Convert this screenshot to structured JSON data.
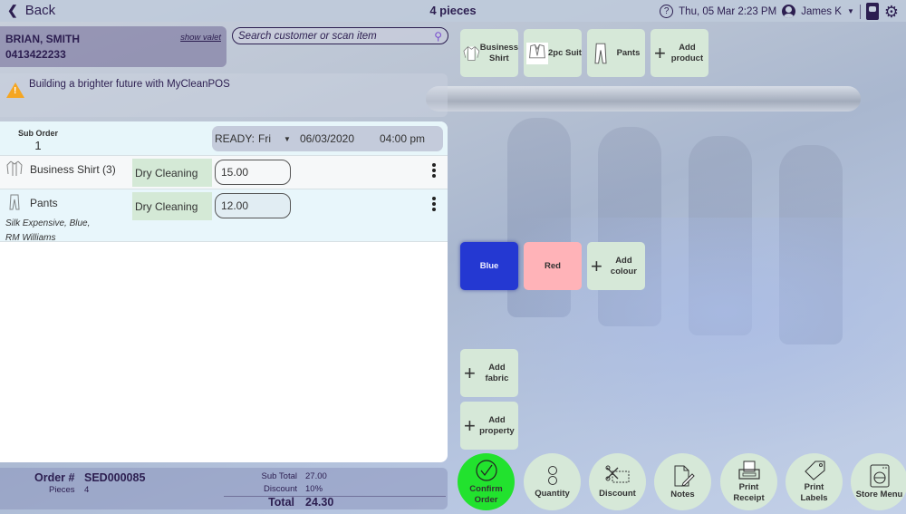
{
  "header": {
    "back_label": "Back",
    "title": "4 pieces",
    "datetime": "Thu, 05 Mar 2:23 PM",
    "user_name": "James K",
    "icons": [
      "help-icon",
      "user-icon",
      "chevron-down-icon",
      "kiosk-icon",
      "gear-icon"
    ]
  },
  "customer": {
    "name": "BRIAN, SMITH",
    "phone": "0413422233",
    "show_valet_label": "show valet"
  },
  "search": {
    "placeholder": "Search customer or scan item",
    "value": ""
  },
  "announcement": {
    "text": "Building a brighter future with MyCleanPOS",
    "icon": "warning-icon"
  },
  "sub_order": {
    "label": "Sub Order",
    "number": "1",
    "ready_label": "READY:",
    "ready_day": "Fri",
    "ready_date": "06/03/2020",
    "ready_time": "04:00 pm"
  },
  "line_items": [
    {
      "icon": "shirt-icon",
      "name": "Business Shirt (3)",
      "service": "Dry Cleaning",
      "price": "15.00",
      "description": ""
    },
    {
      "icon": "pants-icon",
      "name": "Pants",
      "service": "Dry Cleaning",
      "price": "12.00",
      "description_line1": "Silk Expensive, Blue,",
      "description_line2": "RM Williams"
    }
  ],
  "footer": {
    "order_label": "Order #",
    "order_number": "SED000085",
    "pieces_label": "Pieces",
    "pieces_value": "4",
    "subtotal_label": "Sub Total",
    "subtotal_value": "27.00",
    "discount_label": "Discount",
    "discount_value": "10%",
    "total_label": "Total",
    "total_value": "24.30"
  },
  "products": [
    {
      "label_line1": "Business",
      "label_line2": "Shirt",
      "icon": "shirt-icon"
    },
    {
      "label_line1": "2pc Suit",
      "label_line2": "",
      "icon": "suit-icon"
    },
    {
      "label_line1": "Pants",
      "label_line2": "",
      "icon": "pants-icon"
    },
    {
      "label_line1": "Add",
      "label_line2": "product",
      "icon": "plus-icon"
    }
  ],
  "colours": [
    {
      "label": "Blue",
      "color": "#2438d2",
      "selected": true
    },
    {
      "label": "Red",
      "color": "#ffb3b8",
      "selected": false
    },
    {
      "label_line1": "Add",
      "label_line2": "colour",
      "icon": "plus-icon"
    }
  ],
  "fabric_button": {
    "label_line1": "Add",
    "label_line2": "fabric"
  },
  "property_button": {
    "label_line1": "Add",
    "label_line2": "property"
  },
  "actions": [
    {
      "label_line1": "Confirm",
      "label_line2": "Order",
      "icon": "check-circle-icon",
      "color": "#22e22e"
    },
    {
      "label_line1": "Quantity",
      "label_line2": "",
      "icon": "quantity-icon"
    },
    {
      "label_line1": "Discount",
      "label_line2": "",
      "icon": "coupon-scissors-icon"
    },
    {
      "label_line1": "Notes",
      "label_line2": "",
      "icon": "notes-icon"
    },
    {
      "label_line1": "Print",
      "label_line2": "Receipt",
      "icon": "receipt-printer-icon"
    },
    {
      "label_line1": "Print",
      "label_line2": "Labels",
      "icon": "tag-icon"
    },
    {
      "label_line1": "Store Menu",
      "label_line2": "",
      "icon": "washing-machine-icon"
    }
  ]
}
